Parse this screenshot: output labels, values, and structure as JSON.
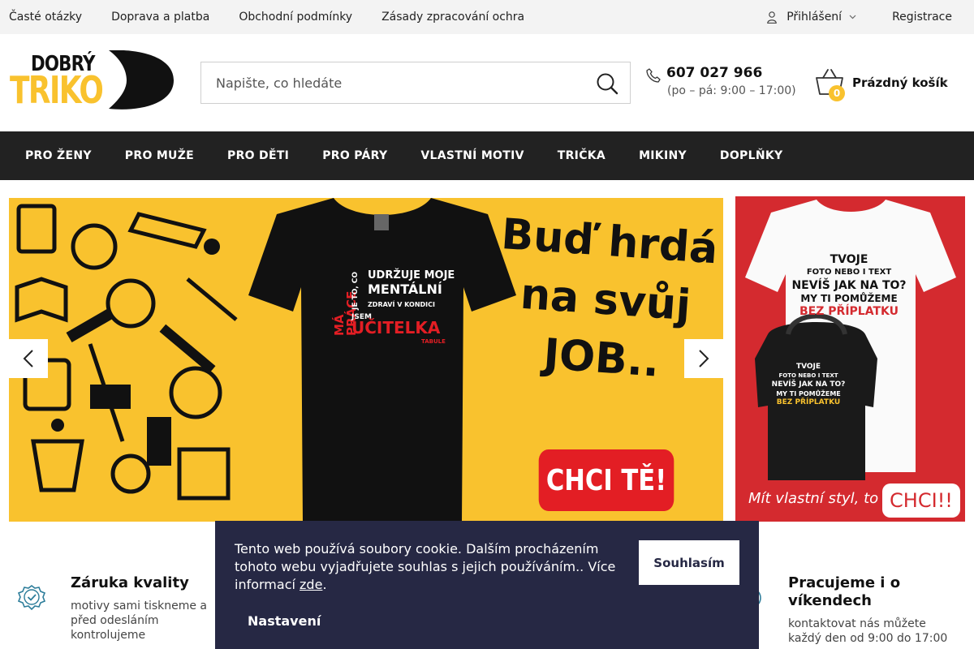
{
  "topbar": {
    "links": [
      "Časté otázky",
      "Doprava a platba",
      "Obchodní podmínky",
      "Zásady zpracování ochra"
    ],
    "login": "Přihlášení",
    "register": "Registrace"
  },
  "header": {
    "logo_line1": "DOBRÝ",
    "logo_line2": "TRIKO",
    "search_placeholder": "Napište, co hledáte",
    "phone": "607 027 966",
    "hours": "(po – pá: 9:00 – 17:00)",
    "cart_count": "0",
    "cart_label": "Prázdný košík"
  },
  "nav": [
    "PRO ŽENY",
    "PRO MUŽE",
    "PRO DĚTI",
    "PRO PÁRY",
    "VLASTNÍ MOTIV",
    "TRIČKA",
    "MIKINY",
    "DOPLŇKY"
  ],
  "hero": {
    "slogan": "Buď hrdá na svůj JOB..",
    "cta": "CHCI TĚ!",
    "shirt_lines": [
      "MÁ PRÁCE",
      "JE TO, CO",
      "UDRŽUJE MOJE",
      "MENTÁLNÍ",
      "ZDRAVÍ V KONDICI",
      "JSEM",
      "UČITELKA",
      "TABULE"
    ]
  },
  "side_banner": {
    "line1": "TVOJE",
    "line2": "FOTO NEBO I TEXT",
    "line3": "NEVÍŠ JAK NA TO?",
    "line4": "MY TI POMŮŽEME",
    "line5": "BEZ PŘÍPLATKU",
    "caption": "Mít vlastní styl, to",
    "cta": "CHCI!!"
  },
  "features": [
    {
      "title": "Záruka kvality",
      "desc": "motivy sami tiskneme a před odesláním kontrolujeme"
    },
    {
      "title": "Pracujeme i o víkendech",
      "desc": "kontaktovat nás můžete každý den od 9:00 do 17:00"
    }
  ],
  "cookie": {
    "text": "Tento web používá soubory cookie. Dalším procházením tohoto webu vyjadřujete souhlas s jejich používáním.. Více informací ",
    "link": "zde",
    "after": ".",
    "accept": "Souhlasím",
    "settings": "Nastavení"
  },
  "colors": {
    "brand_yellow": "#f9c22e",
    "nav_bg": "#222222",
    "cookie_bg": "#262844",
    "banner_red": "#d42a2f",
    "cta_red": "#e31e24"
  }
}
